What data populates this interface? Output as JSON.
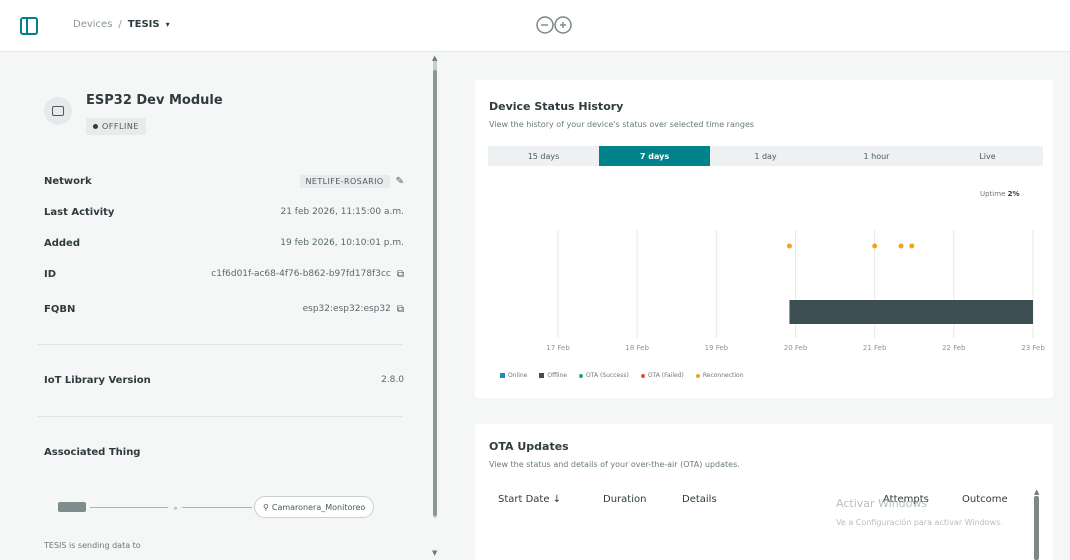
{
  "header": {
    "breadcrumb_parent": "Devices",
    "breadcrumb_separator": "/",
    "breadcrumb_current": "TESIS",
    "breadcrumb_caret": "▾"
  },
  "device": {
    "name": "ESP32 Dev Module",
    "status": "OFFLINE",
    "properties": {
      "network_label": "Network",
      "network_value": "NETLIFE-ROSARIO",
      "last_activity_label": "Last Activity",
      "last_activity_value": "21 feb 2026, 11:15:00 a.m.",
      "added_label": "Added",
      "added_value": "19 feb 2026, 10:10:01 p.m.",
      "id_label": "ID",
      "id_value": "c1f6d01f-ac68-4f76-b862-b97fd178f3cc",
      "fqbn_label": "FQBN",
      "fqbn_value": "esp32:esp32:esp32"
    },
    "iot_library_label": "IoT Library Version",
    "iot_library_value": "2.8.0",
    "associated_thing_label": "Associated Thing",
    "device_chip_label": "TESIS",
    "thing_name": "Camaronera_Monitoreo",
    "sending_text": "TESIS is sending data to"
  },
  "status_history": {
    "title": "Device Status History",
    "subtitle": "View the history of your device's status over selected time ranges",
    "ranges": [
      "15 days",
      "7 days",
      "1 day",
      "1 hour",
      "Live"
    ],
    "active_range": "7 days",
    "uptime_label": "Uptime",
    "uptime_value": "2%"
  },
  "chart_data": {
    "type": "timeline",
    "x_ticks": [
      "17 Feb",
      "18 Feb",
      "19 Feb",
      "20 Feb",
      "21 Feb",
      "22 Feb",
      "23 Feb"
    ],
    "series": [
      {
        "name": "Online",
        "color": "#1a8fbf",
        "segments": []
      },
      {
        "name": "Offline",
        "color": "#3d4f52",
        "segments": [
          {
            "start": "19 Feb 22:10",
            "end": "23 Feb"
          }
        ]
      },
      {
        "name": "OTA (Success)",
        "color": "#1fa67a",
        "events": []
      },
      {
        "name": "OTA (Failed)",
        "color": "#e0533a",
        "events": []
      },
      {
        "name": "Reconnection",
        "color": "#f0a41d",
        "events": [
          "19 Feb 22:10",
          "21 Feb 00:00",
          "21 Feb 08:00",
          "21 Feb 11:15"
        ]
      }
    ]
  },
  "ota": {
    "title": "OTA Updates",
    "subtitle": "View the status and details of your over-the-air (OTA) updates.",
    "columns": [
      "Start Date",
      "Duration",
      "Details",
      "Attempts",
      "Outcome"
    ],
    "sort_icon": "↓"
  },
  "watermark": {
    "line1": "Activar Windows",
    "line2": "Ve a Configuración para activar Windows."
  }
}
